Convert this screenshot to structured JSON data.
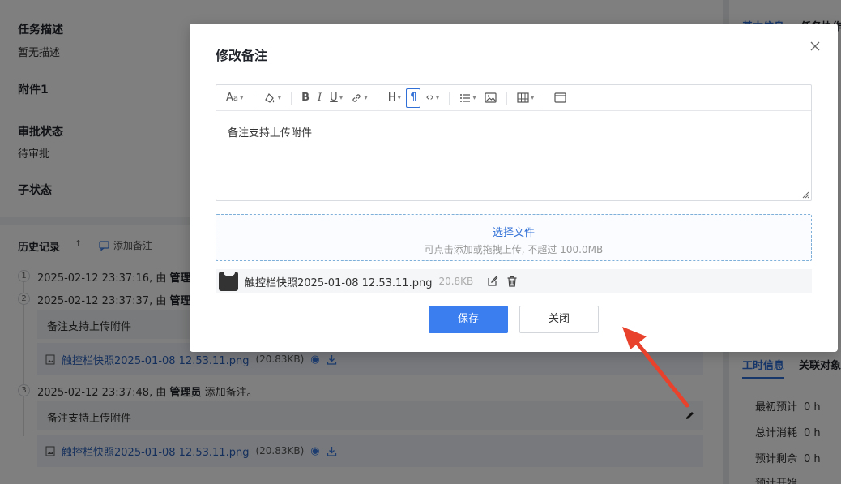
{
  "background": {
    "fields": [
      {
        "label": "任务描述",
        "value": "暂无描述"
      },
      {
        "label": "附件1",
        "value": ""
      },
      {
        "label": "审批状态",
        "value": "待审批"
      },
      {
        "label": "子状态",
        "value": ""
      }
    ],
    "history": {
      "title": "历史记录",
      "sort_glyph": "↑",
      "add_note_label": "添加备注",
      "entries": [
        {
          "num": "1",
          "time_prefix": "2025-02-12 23:37:16, 由 ",
          "user": "管理员"
        },
        {
          "num": "2",
          "time_prefix": "2025-02-12 23:37:37, 由 ",
          "user": "管理员",
          "note": "备注支持上传附件",
          "file": "触控栏快照2025-01-08 12.53.11.png",
          "file_size": "(20.83KB)"
        },
        {
          "num": "3",
          "time_prefix": "2025-02-12 23:37:48, 由 ",
          "user": "管理员",
          "action": " 添加备注。",
          "note": "备注支持上传附件",
          "file": "触控栏快照2025-01-08 12.53.11.png",
          "file_size": "(20.83KB)"
        }
      ]
    },
    "side": {
      "top_tabs": [
        "基本信息",
        "任务协作"
      ],
      "tabs": [
        "工时信息",
        "关联对象"
      ],
      "stats": [
        {
          "label": "最初预计",
          "value": "0 h"
        },
        {
          "label": "总计消耗",
          "value": "0 h"
        },
        {
          "label": "预计剩余",
          "value": "0 h"
        },
        {
          "label": "预计开始",
          "value": ""
        }
      ]
    }
  },
  "modal": {
    "title": "修改备注",
    "editor_content": "备注支持上传附件",
    "upload": {
      "title": "选择文件",
      "hint": "可点击添加或拖拽上传, 不超过 100.0MB"
    },
    "attachment": {
      "name": "触控栏快照2025-01-08 12.53.11.png",
      "size": "20.8KB"
    },
    "save_label": "保存",
    "close_label": "关闭"
  },
  "colors": {
    "primary": "#3a7ef0",
    "link": "#2f6fd6",
    "arrow": "#e8412c"
  }
}
